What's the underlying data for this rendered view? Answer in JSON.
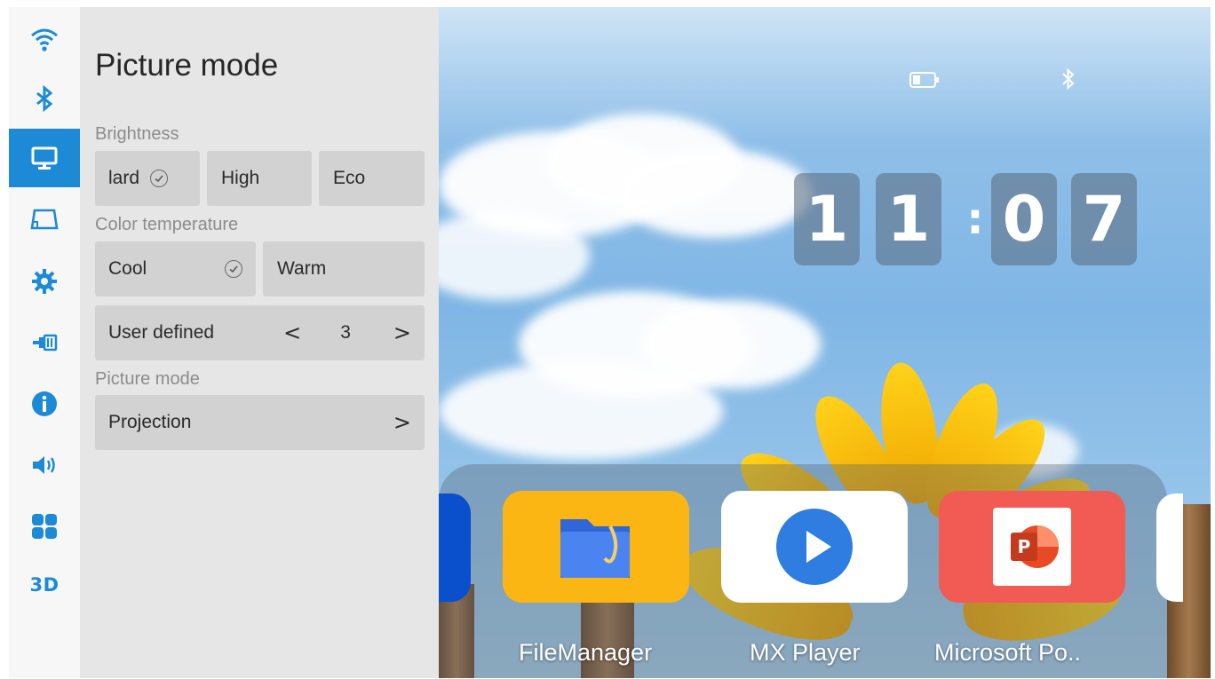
{
  "panel": {
    "title": "Picture mode",
    "brightness": {
      "label": "Brightness",
      "options": [
        "lard",
        "High",
        "Eco"
      ]
    },
    "color_temperature": {
      "label": "Color temperature",
      "options": [
        "Cool",
        "Warm"
      ],
      "user_defined_label": "User defined",
      "user_defined_value": "3",
      "prev_arrow": "<",
      "next_arrow": ">"
    },
    "picture_mode": {
      "label": "Picture mode",
      "value": "Projection",
      "arrow": ">"
    }
  },
  "rail": {
    "items": [
      "wifi-icon",
      "bluetooth-icon",
      "display-icon",
      "projection-icon",
      "gear-icon",
      "input-source-icon",
      "info-icon",
      "volume-icon",
      "apps-icon"
    ],
    "last_label": "3D",
    "active_index": 2
  },
  "clock": {
    "h1": "1",
    "h2": "1",
    "colon": ":",
    "m1": "0",
    "m2": "7"
  },
  "dock": {
    "apps": [
      {
        "label": "FileManager",
        "icon": "folder-icon",
        "color": "#fbb614"
      },
      {
        "label": "MX Player",
        "icon": "play-icon",
        "color": "#ffffff"
      },
      {
        "label": "Microsoft Po..",
        "icon": "powerpoint-icon",
        "color": "#f25b54"
      }
    ]
  },
  "colors": {
    "accent": "#1d8ad6",
    "panel_bg": "#e6e6e6",
    "button_bg": "#d2d2d2"
  }
}
